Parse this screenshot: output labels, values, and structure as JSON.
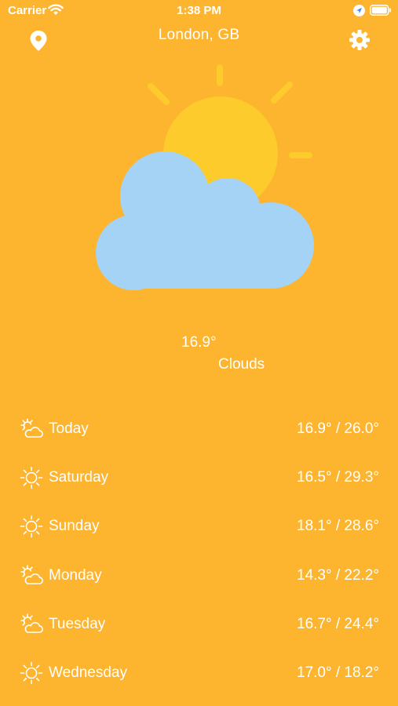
{
  "status_bar": {
    "carrier": "Carrier",
    "time": "1:38 PM",
    "icons": [
      "wifi-icon",
      "location-services-icon",
      "battery-icon"
    ]
  },
  "header": {
    "location_icon": "location-pin-icon",
    "city": "London, GB",
    "settings_icon": "gear-icon"
  },
  "current": {
    "illustration": "sun-behind-cloud-icon",
    "temperature": "16.9°",
    "condition": "Clouds"
  },
  "forecast": [
    {
      "icon": "partly-cloudy-icon",
      "day": "Today",
      "range": "16.9° / 26.0°"
    },
    {
      "icon": "sun-icon",
      "day": "Saturday",
      "range": "16.5° / 29.3°"
    },
    {
      "icon": "sun-icon",
      "day": "Sunday",
      "range": "18.1° / 28.6°"
    },
    {
      "icon": "partly-cloudy-icon",
      "day": "Monday",
      "range": "14.3° / 22.2°"
    },
    {
      "icon": "partly-cloudy-icon",
      "day": "Tuesday",
      "range": "16.7° / 24.4°"
    },
    {
      "icon": "sun-icon",
      "day": "Wednesday",
      "range": "17.0° / 18.2°"
    }
  ],
  "colors": {
    "background": "#FDB42E",
    "sun": "#FDCB2B",
    "cloud": "#A4D3F5",
    "foreground": "#FFFFFF"
  }
}
